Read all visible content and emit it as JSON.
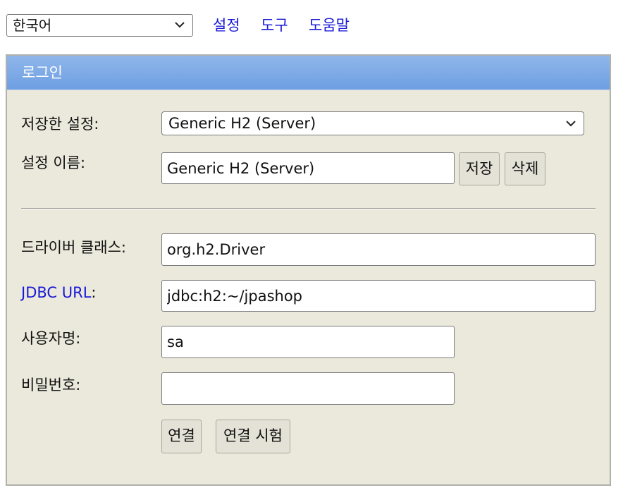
{
  "top_bar": {
    "language_selected": "한국어",
    "links": [
      "설정",
      "도구",
      "도움말"
    ]
  },
  "login": {
    "header_title": "로그인",
    "saved_settings_label": "저장한 설정:",
    "saved_settings_value": "Generic H2 (Server)",
    "setting_name_label": "설정 이름:",
    "setting_name_value": "Generic H2 (Server)",
    "save_button": "저장",
    "delete_button": "삭제",
    "driver_class_label": "드라이버 클래스:",
    "driver_class_value": "org.h2.Driver",
    "jdbc_url_label": "JDBC URL",
    "jdbc_url_colon": ":",
    "jdbc_url_value": "jdbc:h2:~/jpashop",
    "username_label": "사용자명:",
    "username_value": "sa",
    "password_label": "비밀번호:",
    "password_value": "",
    "connect_button": "연결",
    "test_connection_button": "연결 시험"
  },
  "icons": {
    "dropdown": "chevron-down-icon"
  },
  "colors": {
    "link": "#1a1ad6",
    "header_bg": "#7aa8e6",
    "panel_bg": "#ebe9dc"
  }
}
